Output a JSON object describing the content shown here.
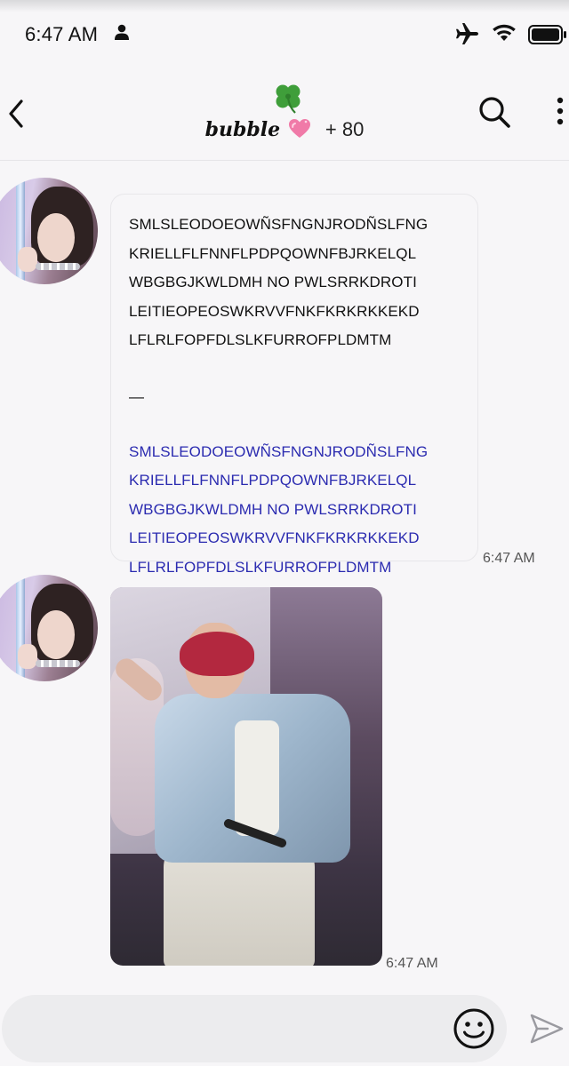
{
  "status_bar": {
    "time": "6:47 AM",
    "icons": [
      "person-icon",
      "airplane-icon",
      "wifi-icon",
      "battery-icon"
    ]
  },
  "header": {
    "emoji": "🍀",
    "name": "bubble",
    "heart": "💗",
    "count": "+ 80",
    "icons": [
      "back-icon",
      "search-icon",
      "more-icon"
    ]
  },
  "messages": [
    {
      "type": "text",
      "lines": [
        "SMLSLEODOEOWÑSFNGNJRODÑSLFNG",
        "KRIELLFLFNNFLPDPQOWNFBJRKELQL",
        "WBGBGJKWLDMH NO PWLSRRKDROTI",
        "LEITIEOPEOSWKRVVFNKFKRKRKKEKD",
        "LFLRLFOPFDLSLKFURROFPLDMTM"
      ],
      "separator": "—",
      "translated_lines": [
        "SMLSLEODOEOWÑSFNGNJRODÑSLFNG",
        "KRIELLFLFNNFLPDPQOWNFBJRKELQL",
        "WBGBGJKWLDMH NO PWLSRRKDROTI",
        "LEITIEOPEOSWKRVVFNKFKRKRKKEKD",
        "LFLRLFOPFDLSLKFURROFPLDMTM"
      ],
      "time": "6:47 AM"
    },
    {
      "type": "photo",
      "time": "6:47 AM"
    }
  ],
  "composer": {
    "value": "",
    "placeholder": "",
    "icons": [
      "emoji-icon",
      "send-icon"
    ]
  },
  "colors": {
    "background": "#f7f6f8",
    "translated_text": "#2b2bb0",
    "composer": "#ececee"
  }
}
